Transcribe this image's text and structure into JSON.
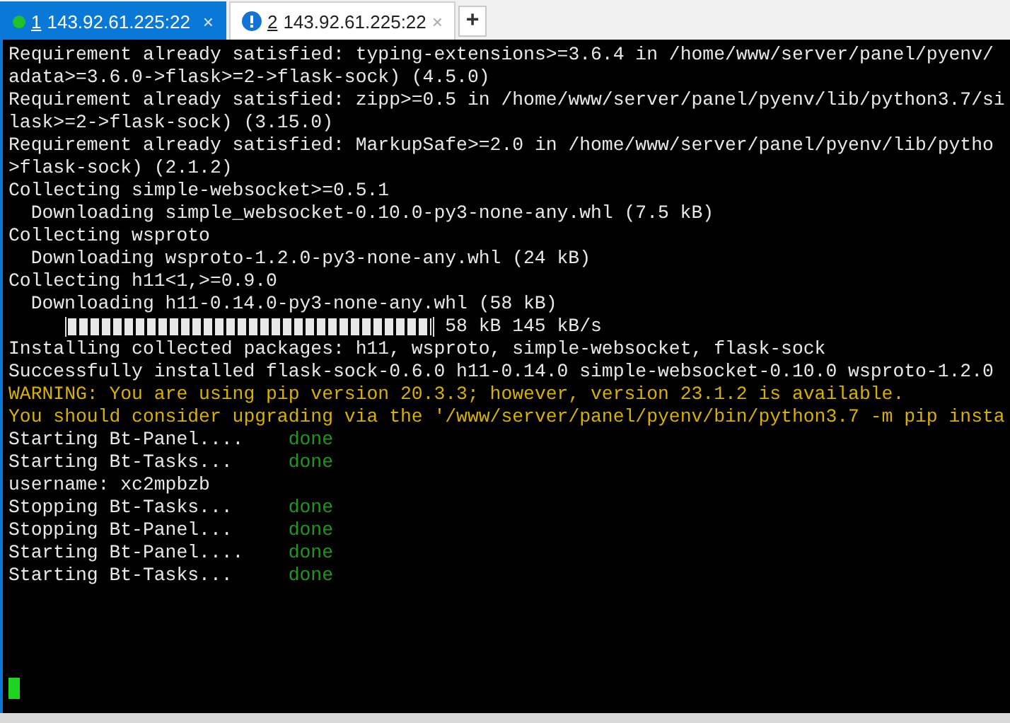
{
  "tabs": [
    {
      "number": "1",
      "title": "143.92.61.225:22",
      "kind": "connected",
      "selected": true,
      "close": "×"
    },
    {
      "number": "2",
      "title": "143.92.61.225:22",
      "kind": "alert",
      "selected": false,
      "close": "×"
    }
  ],
  "new_tab": "+",
  "terminal": {
    "lines": [
      {
        "kind": "plain",
        "text": "Requirement already satisfied: typing-extensions>=3.6.4 in /home/www/server/panel/pyenv/"
      },
      {
        "kind": "plain",
        "text": "adata>=3.6.0->flask>=2->flask-sock) (4.5.0)"
      },
      {
        "kind": "plain",
        "text": "Requirement already satisfied: zipp>=0.5 in /home/www/server/panel/pyenv/lib/python3.7/si"
      },
      {
        "kind": "plain",
        "text": "lask>=2->flask-sock) (3.15.0)"
      },
      {
        "kind": "plain",
        "text": "Requirement already satisfied: MarkupSafe>=2.0 in /home/www/server/panel/pyenv/lib/pytho"
      },
      {
        "kind": "plain",
        "text": ">flask-sock) (2.1.2)"
      },
      {
        "kind": "plain",
        "text": "Collecting simple-websocket>=0.5.1"
      },
      {
        "kind": "indented",
        "text": "Downloading simple_websocket-0.10.0-py3-none-any.whl (7.5 kB)"
      },
      {
        "kind": "plain",
        "text": "Collecting wsproto"
      },
      {
        "kind": "indented",
        "text": "Downloading wsproto-1.2.0-py3-none-any.whl (24 kB)"
      },
      {
        "kind": "plain",
        "text": "Collecting h11<1,>=0.9.0"
      },
      {
        "kind": "indented",
        "text": "Downloading h11-0.14.0-py3-none-any.whl (58 kB)"
      },
      {
        "kind": "progress",
        "level": 1,
        "text": "58 kB 145 kB/s"
      },
      {
        "kind": "plain",
        "text": "Installing collected packages: h11, wsproto, simple-websocket, flask-sock"
      },
      {
        "kind": "plain",
        "text": "Successfully installed flask-sock-0.6.0 h11-0.14.0 simple-websocket-0.10.0 wsproto-1.2.0"
      },
      {
        "kind": "warning",
        "text": "WARNING: You are using pip version 20.3.3; however, version 23.1.2 is available."
      },
      {
        "kind": "warning",
        "text": "You should consider upgrading via the '/www/server/panel/pyenv/bin/python3.7 -m pip insta"
      },
      {
        "kind": "status",
        "text": "Starting Bt-Panel....",
        "status": "done"
      },
      {
        "kind": "status",
        "text": "Starting Bt-Tasks...",
        "status": "done"
      },
      {
        "kind": "plain",
        "text": "username: xc2mpbzb"
      },
      {
        "kind": "status",
        "text": "Stopping Bt-Tasks...",
        "status": "done"
      },
      {
        "kind": "status",
        "text": "Stopping Bt-Panel...",
        "status": "done"
      },
      {
        "kind": "status",
        "text": "Starting Bt-Panel....",
        "status": "done"
      },
      {
        "kind": "status",
        "text": "Starting Bt-Tasks...",
        "status": "done"
      }
    ]
  }
}
